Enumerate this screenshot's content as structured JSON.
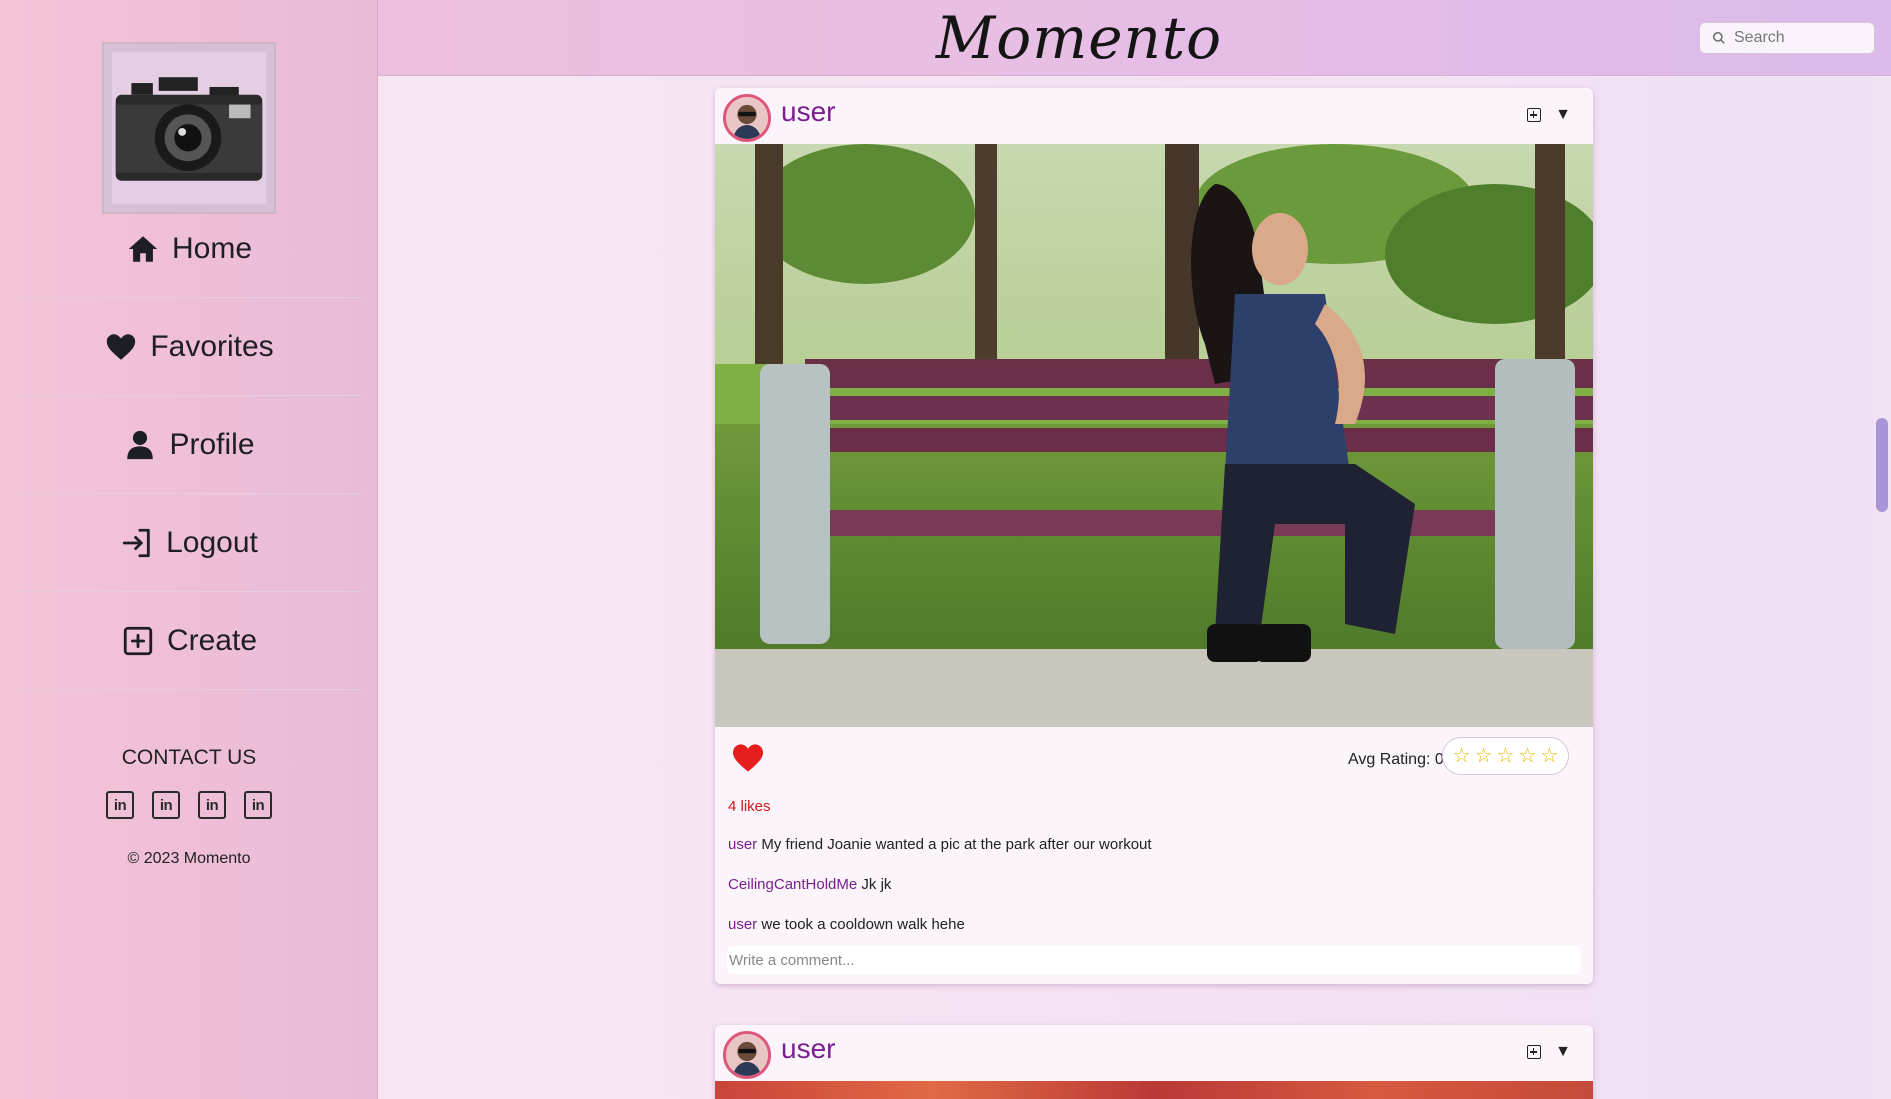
{
  "app": {
    "title": "Momento"
  },
  "sidebar": {
    "nav": [
      {
        "label": "Home",
        "icon": "home-icon"
      },
      {
        "label": "Favorites",
        "icon": "heart-icon"
      },
      {
        "label": "Profile",
        "icon": "person-icon"
      },
      {
        "label": "Logout",
        "icon": "logout-icon"
      },
      {
        "label": "Create",
        "icon": "plus-square-icon"
      }
    ],
    "contact_title": "CONTACT US",
    "socials": [
      "in",
      "in",
      "in",
      "in"
    ],
    "copyright": "© 2023 Momento"
  },
  "search": {
    "placeholder": "Search"
  },
  "posts": [
    {
      "username": "user",
      "likes": "4 likes",
      "avg_rating": "Avg Rating: 0",
      "stars": [
        "☆",
        "☆",
        "☆",
        "☆",
        "☆"
      ],
      "comments": [
        {
          "user": "user",
          "text": "My friend Joanie wanted a pic at the park after our workout"
        },
        {
          "user": "CeilingCantHoldMe",
          "text": "Jk jk"
        },
        {
          "user": "user",
          "text": "we took a cooldown walk hehe"
        }
      ],
      "comment_placeholder": "Write a comment..."
    },
    {
      "username": "user"
    }
  ],
  "colors": {
    "accent": "#7a1f8e",
    "like": "#d31a1a",
    "star": "#e3b900"
  }
}
